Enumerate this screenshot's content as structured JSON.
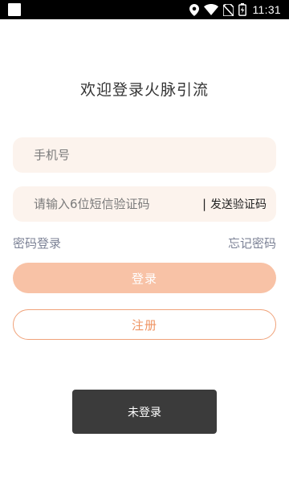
{
  "status_bar": {
    "time": "11:31",
    "icons": [
      "notification-square-icon",
      "location-icon",
      "wifi-icon",
      "no-sim-icon",
      "battery-charging-icon"
    ]
  },
  "login": {
    "title": "欢迎登录火脉引流",
    "phone_placeholder": "手机号",
    "code_placeholder": "请输入6位短信验证码",
    "code_separator": "|",
    "send_code_label": "发送验证码",
    "password_login_link": "密码登录",
    "forgot_password_link": "忘记密码",
    "login_button": "登录",
    "register_button": "注册"
  },
  "toast": {
    "message": "未登录"
  },
  "colors": {
    "field_bg": "#fcf3ed",
    "login_button_bg": "#f8c2a6",
    "register_accent": "#ef9463",
    "link_text": "#7c8296",
    "toast_bg": "#3b3b3b"
  }
}
